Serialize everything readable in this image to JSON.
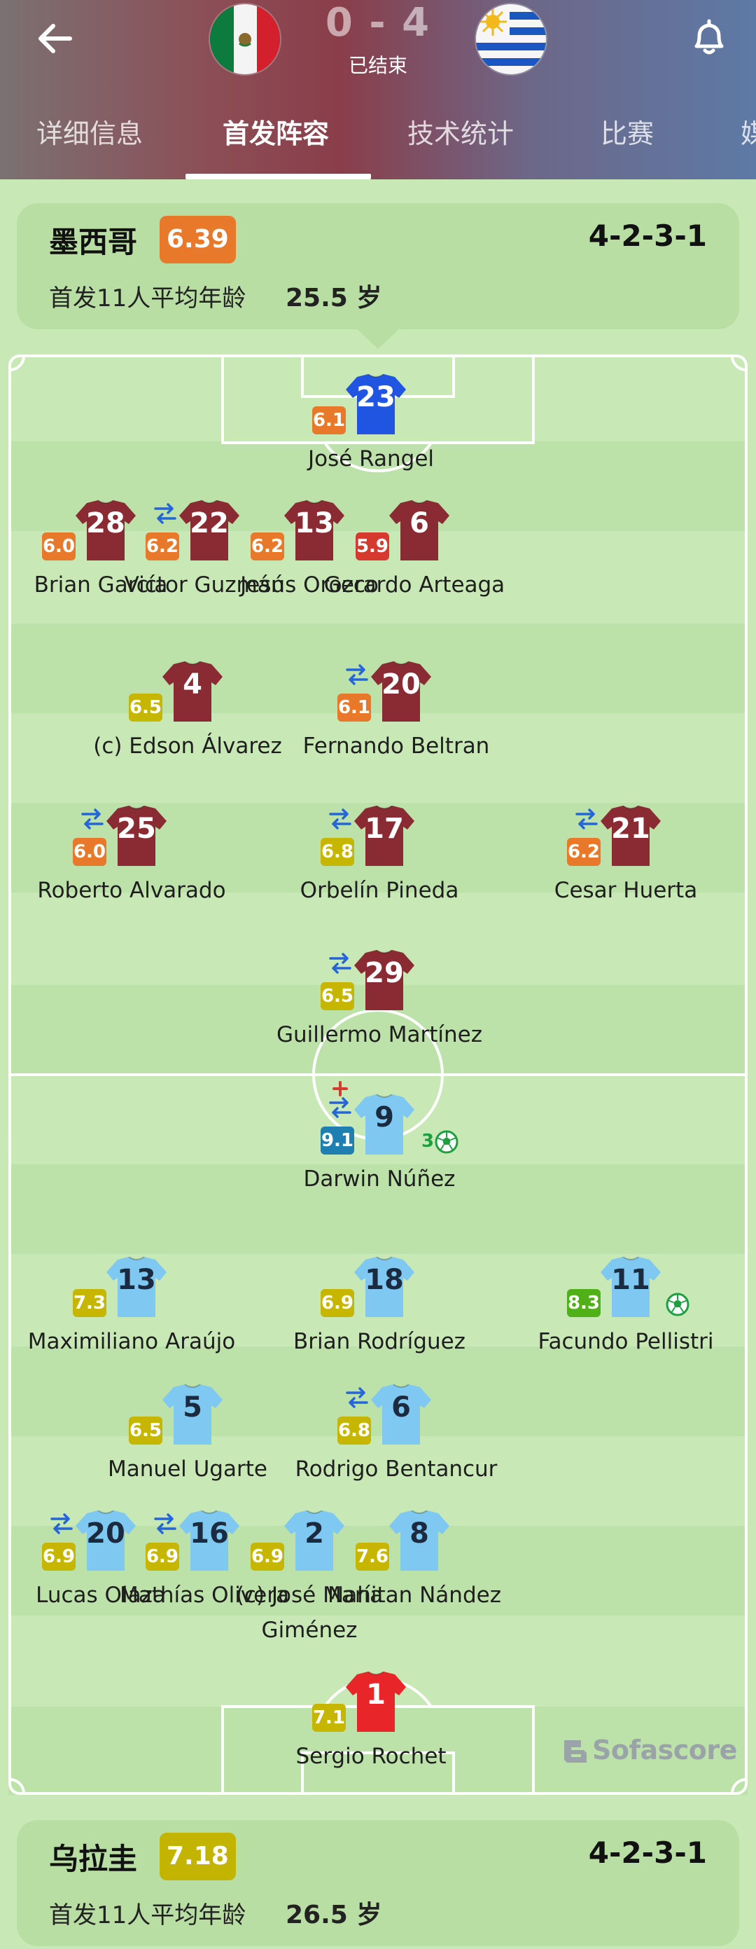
{
  "match": {
    "score": "0 - 4",
    "status": "已结束",
    "home_flag": "mexico-flag",
    "away_flag": "uruguay-flag"
  },
  "tabs": [
    "详细信息",
    "首发阵容",
    "技术统计",
    "比赛",
    "媒"
  ],
  "active_tab": "首发阵容",
  "home_team": {
    "name": "墨西哥",
    "rating": "6.39",
    "rating_color": "#e8782a",
    "formation": "4-2-3-1",
    "avg_age_label": "首发11人平均年龄",
    "avg_age_value": "25.5 岁",
    "shirt_color": "#8a2a32",
    "gk_shirt_color": "#1f55e0"
  },
  "away_team": {
    "name": "乌拉圭",
    "rating": "7.18",
    "rating_color": "#c2b400",
    "formation": "4-2-3-1",
    "avg_age_label": "首发11人平均年龄",
    "avg_age_value": "26.5 岁",
    "shirt_color": "#7ec8f2",
    "gk_shirt_color": "#e8262a"
  },
  "rating_colors": {
    "red": "#d63a2f",
    "orange": "#e8782a",
    "yellow": "#c7b600",
    "green": "#4fb018",
    "blue": "#1e7fb0"
  },
  "home_players": [
    {
      "number": "23",
      "name": "José Rangel",
      "rating": "6.1",
      "rating_level": "orange",
      "gk": true,
      "sub": false
    },
    {
      "number": "28",
      "name": "Brian García",
      "rating": "6.0",
      "rating_level": "orange",
      "sub": false
    },
    {
      "number": "22",
      "name": "Victor Guzmán",
      "rating": "6.2",
      "rating_level": "orange",
      "sub": true
    },
    {
      "number": "13",
      "name": "Jesús Orozco",
      "rating": "6.2",
      "rating_level": "orange",
      "sub": false
    },
    {
      "number": "6",
      "name": "Gerardo Arteaga",
      "rating": "5.9",
      "rating_level": "red",
      "sub": false
    },
    {
      "number": "4",
      "name": "(c) Edson Álvarez",
      "rating": "6.5",
      "rating_level": "yellow",
      "sub": false
    },
    {
      "number": "20",
      "name": "Fernando Beltran",
      "rating": "6.1",
      "rating_level": "orange",
      "sub": true
    },
    {
      "number": "25",
      "name": "Roberto Alvarado",
      "rating": "6.0",
      "rating_level": "orange",
      "sub": true
    },
    {
      "number": "17",
      "name": "Orbelín Pineda",
      "rating": "6.8",
      "rating_level": "yellow",
      "sub": true
    },
    {
      "number": "21",
      "name": "Cesar Huerta",
      "rating": "6.2",
      "rating_level": "orange",
      "sub": true
    },
    {
      "number": "29",
      "name": "Guillermo Martínez",
      "rating": "6.5",
      "rating_level": "yellow",
      "sub": true
    }
  ],
  "away_players": [
    {
      "number": "9",
      "name": "Darwin Núñez",
      "rating": "9.1",
      "rating_level": "blue",
      "sub": true,
      "goals": "3"
    },
    {
      "number": "13",
      "name": "Maximiliano Araújo",
      "rating": "7.3",
      "rating_level": "yellow",
      "sub": false
    },
    {
      "number": "18",
      "name": "Brian Rodríguez",
      "rating": "6.9",
      "rating_level": "yellow",
      "sub": false
    },
    {
      "number": "11",
      "name": "Facundo Pellistri",
      "rating": "8.3",
      "rating_level": "green",
      "sub": false,
      "goal": true
    },
    {
      "number": "5",
      "name": "Manuel Ugarte",
      "rating": "6.5",
      "rating_level": "yellow",
      "sub": false
    },
    {
      "number": "6",
      "name": "Rodrigo Bentancur",
      "rating": "6.8",
      "rating_level": "yellow",
      "sub": true
    },
    {
      "number": "20",
      "name": "Lucas Olaza",
      "rating": "6.9",
      "rating_level": "yellow",
      "sub": true
    },
    {
      "number": "16",
      "name": "Mathías Olivera",
      "rating": "6.9",
      "rating_level": "yellow",
      "sub": true
    },
    {
      "number": "2",
      "name": "(c) José María Giménez",
      "rating": "6.9",
      "rating_level": "yellow",
      "sub": false
    },
    {
      "number": "8",
      "name": "Nahitan Nández",
      "rating": "7.6",
      "rating_level": "yellow",
      "sub": false
    },
    {
      "number": "1",
      "name": "Sergio Rochet",
      "rating": "7.1",
      "rating_level": "yellow",
      "gk": true,
      "sub": false
    }
  ],
  "watermark": "Sofascore"
}
